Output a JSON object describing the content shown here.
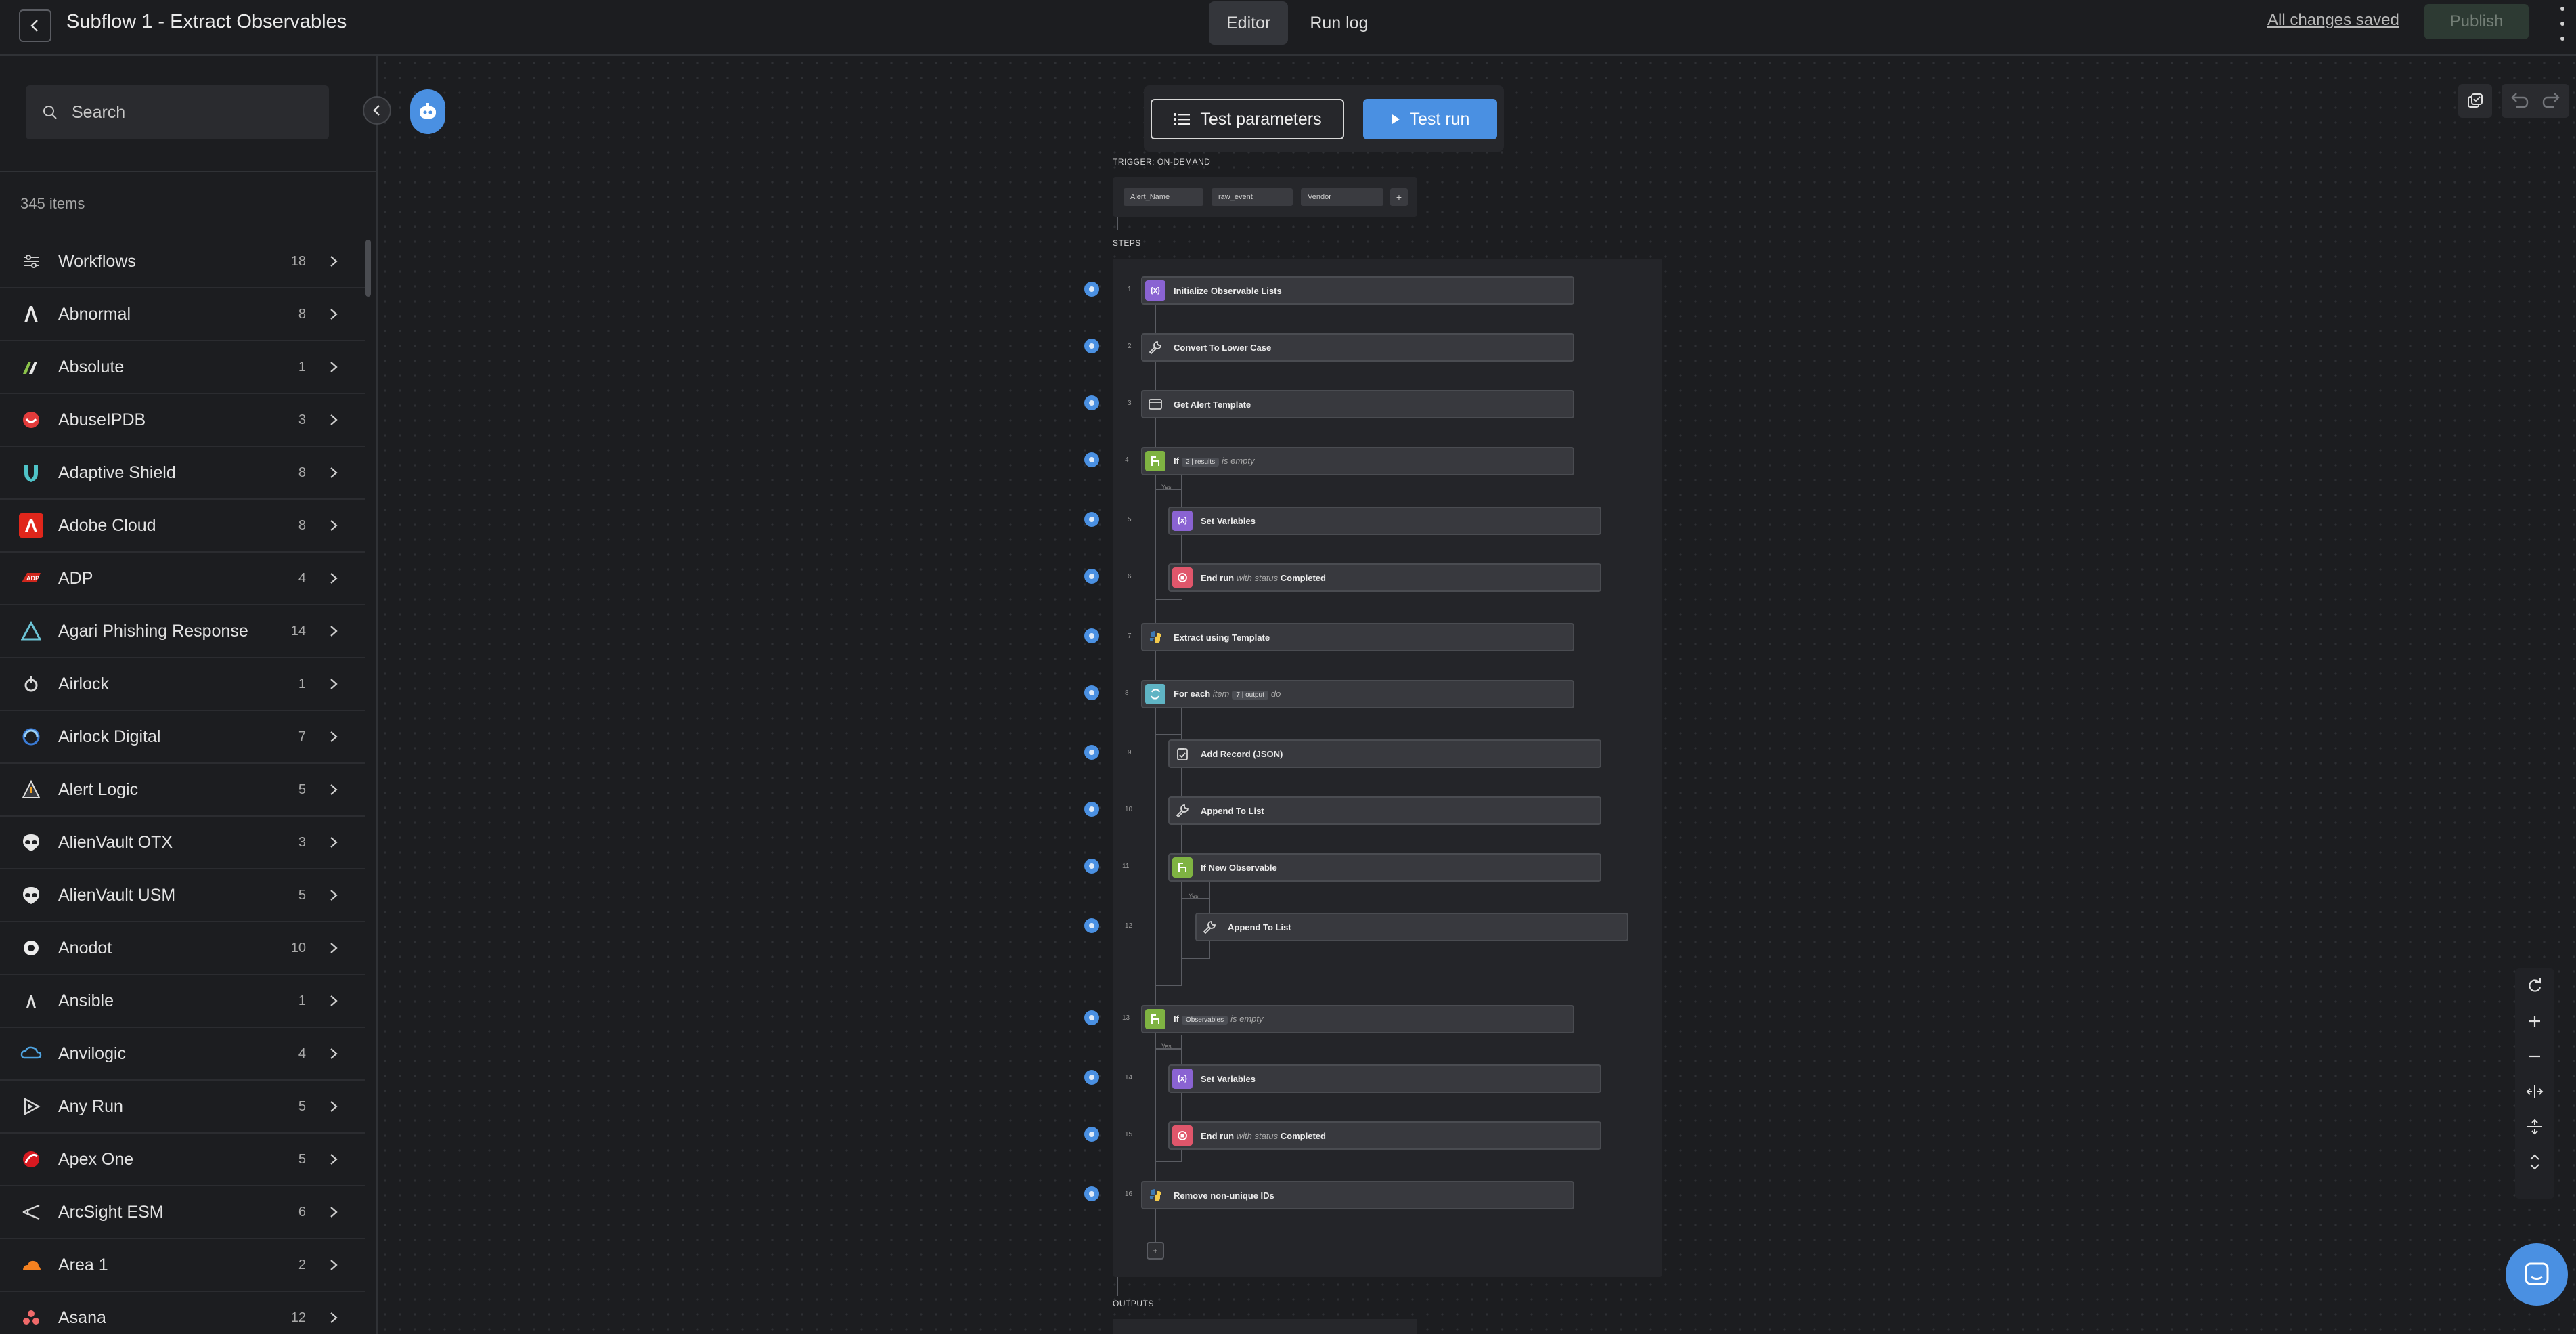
{
  "header": {
    "title": "Subflow 1 - Extract Observables",
    "modes": [
      "Editor",
      "Run log"
    ],
    "active_mode": "Editor",
    "save_status": "All changes saved",
    "publish_label": "Publish"
  },
  "sidebar": {
    "search_placeholder": "Search",
    "items_count": "345 items",
    "items": [
      {
        "name": "Workflows",
        "count": "18",
        "icon": "workflows-icon"
      },
      {
        "name": "Abnormal",
        "count": "8",
        "icon": "abnormal-logo"
      },
      {
        "name": "Absolute",
        "count": "1",
        "icon": "absolute-logo"
      },
      {
        "name": "AbuseIPDB",
        "count": "3",
        "icon": "abuseipdb-logo"
      },
      {
        "name": "Adaptive Shield",
        "count": "8",
        "icon": "adaptive-shield-logo"
      },
      {
        "name": "Adobe Cloud",
        "count": "8",
        "icon": "adobe-logo"
      },
      {
        "name": "ADP",
        "count": "4",
        "icon": "adp-logo"
      },
      {
        "name": "Agari Phishing Response",
        "count": "14",
        "icon": "agari-logo"
      },
      {
        "name": "Airlock",
        "count": "1",
        "icon": "airlock-logo"
      },
      {
        "name": "Airlock Digital",
        "count": "7",
        "icon": "airlock-digital-logo"
      },
      {
        "name": "Alert Logic",
        "count": "5",
        "icon": "alert-logic-logo"
      },
      {
        "name": "AlienVault OTX",
        "count": "3",
        "icon": "alienvault-logo"
      },
      {
        "name": "AlienVault USM",
        "count": "5",
        "icon": "alienvault-logo"
      },
      {
        "name": "Anodot",
        "count": "10",
        "icon": "anodot-logo"
      },
      {
        "name": "Ansible",
        "count": "1",
        "icon": "ansible-logo"
      },
      {
        "name": "Anvilogic",
        "count": "4",
        "icon": "anvilogic-logo"
      },
      {
        "name": "Any Run",
        "count": "5",
        "icon": "any-run-logo"
      },
      {
        "name": "Apex One",
        "count": "5",
        "icon": "apex-one-logo"
      },
      {
        "name": "ArcSight ESM",
        "count": "6",
        "icon": "arcsight-logo"
      },
      {
        "name": "Area 1",
        "count": "2",
        "icon": "area1-logo"
      },
      {
        "name": "Asana",
        "count": "12",
        "icon": "asana-logo"
      }
    ]
  },
  "canvas": {
    "test_parameters_label": "Test parameters",
    "test_run_label": "Test run",
    "trigger_label": "TRIGGER: ON-DEMAND",
    "trigger_params": [
      "Alert_Name",
      "raw_event",
      "Vendor"
    ],
    "steps_label": "STEPS",
    "outputs_label": "OUTPUTS",
    "steps": [
      {
        "no": "1",
        "label": "Initialize Observable Lists"
      },
      {
        "no": "2",
        "label": "Convert To Lower Case"
      },
      {
        "no": "3",
        "label": "Get Alert Template"
      },
      {
        "no": "4",
        "label_if": "If",
        "chip": "2 | results",
        "label_tail": "is empty"
      },
      {
        "no": "5",
        "label": "Set Variables"
      },
      {
        "no": "6",
        "label_pre": "End run",
        "label_mid": "with status",
        "label_post": "Completed"
      },
      {
        "no": "7",
        "label": "Extract using Template"
      },
      {
        "no": "8",
        "label_pre": "For each",
        "label_mid": "item",
        "chip": "7 | output",
        "label_post": "do"
      },
      {
        "no": "9",
        "label": "Add Record (JSON)"
      },
      {
        "no": "10",
        "label": "Append To List"
      },
      {
        "no": "11",
        "label": "If New Observable"
      },
      {
        "no": "12",
        "label": "Append To List"
      },
      {
        "no": "13",
        "label_if": "If",
        "chip": "Observables",
        "label_tail": "is empty"
      },
      {
        "no": "14",
        "label": "Set Variables"
      },
      {
        "no": "15",
        "label_pre": "End run",
        "label_mid": "with status",
        "label_post": "Completed"
      },
      {
        "no": "16",
        "label": "Remove non-unique IDs"
      }
    ],
    "branch_yes": "Yes"
  },
  "colors": {
    "accent_blue": "#4a90e2",
    "variables_purple": "#8a63d2",
    "condition_green": "#7fb342",
    "end_red": "#e0566b",
    "loop_teal": "#5fb4c4"
  }
}
